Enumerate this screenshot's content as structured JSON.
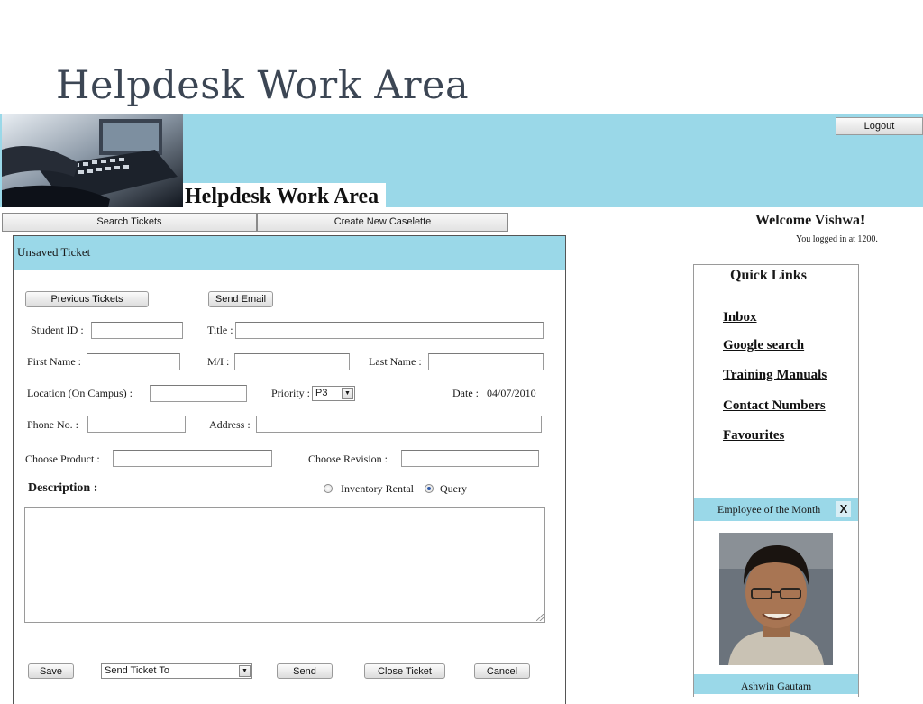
{
  "slide": {
    "title": "Helpdesk Work Area"
  },
  "header": {
    "title": "Helpdesk Work Area",
    "logout_label": "Logout"
  },
  "tabs": [
    {
      "label": "Search Tickets"
    },
    {
      "label": "Create New Caselette"
    }
  ],
  "ticket": {
    "panel_title": "Unsaved Ticket",
    "previous_tickets_label": "Previous Tickets",
    "send_email_label": "Send Email",
    "fields": {
      "student_id": {
        "label": "Student ID :",
        "value": ""
      },
      "title": {
        "label": "Title :",
        "value": ""
      },
      "first_name": {
        "label": "First Name :",
        "value": ""
      },
      "mi": {
        "label": "M/I :",
        "value": ""
      },
      "last_name": {
        "label": "Last Name :",
        "value": ""
      },
      "location": {
        "label": "Location (On Campus) :",
        "value": ""
      },
      "priority": {
        "label": "Priority :",
        "value": "P3"
      },
      "date": {
        "label": "Date :",
        "value": "04/07/2010"
      },
      "phone": {
        "label": "Phone No. :",
        "value": ""
      },
      "address": {
        "label": "Address :",
        "value": ""
      },
      "product": {
        "label": "Choose Product :",
        "value": ""
      },
      "revision": {
        "label": "Choose Revision :",
        "value": ""
      }
    },
    "description_label": "Description :",
    "description_value": "",
    "type_options": [
      {
        "label": "Inventory Rental",
        "selected": false
      },
      {
        "label": "Query",
        "selected": true
      }
    ],
    "actions": {
      "save": "Save",
      "send_to": "Send Ticket To",
      "send": "Send",
      "close_ticket": "Close Ticket",
      "cancel": "Cancel"
    }
  },
  "user": {
    "welcome": "Welcome Vishwa!",
    "login_info": "You logged in at 1200."
  },
  "quick_links": {
    "title": "Quick Links",
    "items": [
      {
        "label": "Inbox"
      },
      {
        "label": "Google search"
      },
      {
        "label": "Training Manuals"
      },
      {
        "label": "Contact Numbers"
      },
      {
        "label": "Favourites"
      }
    ]
  },
  "employee_of_month": {
    "title": "Employee of the Month",
    "close_label": "X",
    "name": "Ashwin Gautam"
  },
  "colors": {
    "accent": "#9ad8e8",
    "radio_selected": "#2f5aa8"
  },
  "icons": [
    "dropdown-arrow-icon",
    "close-icon",
    "resize-grip-icon"
  ]
}
